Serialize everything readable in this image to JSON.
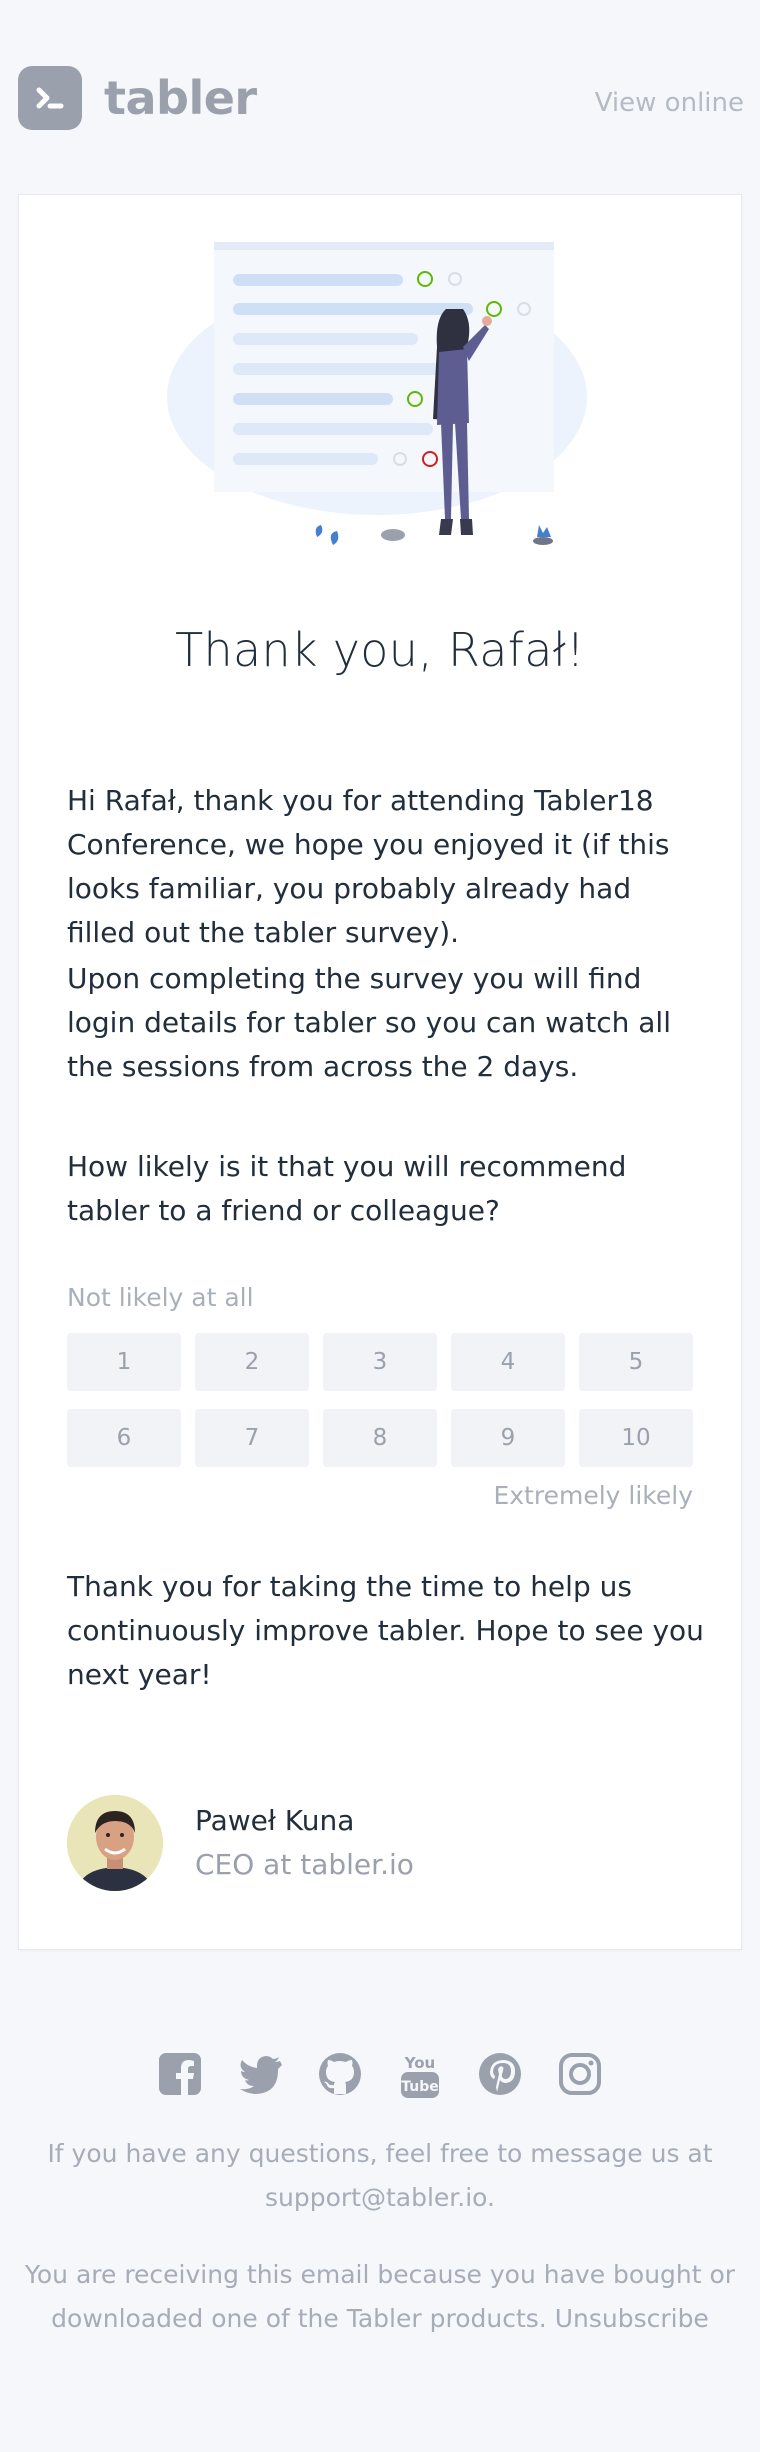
{
  "header": {
    "brand": "tabler",
    "view_online": "View online"
  },
  "card": {
    "title": "Thank you, Rafał!",
    "paragraphs": [
      "Hi Rafał, thank you for attending Tabler18 Conference, we hope you enjoyed it (if this looks familiar, you probably already had filled out the tabler survey).",
      "Upon completing the survey you will find login details for tabler so you can watch all the sessions from across the 2 days.",
      "How likely is it that you will recommend tabler to a friend or colleague?"
    ],
    "scale": {
      "low_label": "Not likely at all",
      "high_label": "Extremely likely",
      "options": [
        "1",
        "2",
        "3",
        "4",
        "5",
        "6",
        "7",
        "8",
        "9",
        "10"
      ]
    },
    "closing": "Thank you for taking the time to help us continuously improve tabler. Hope to see you next year!",
    "signature": {
      "name": "Paweł Kuna",
      "role": "CEO at tabler.io"
    }
  },
  "social": [
    "facebook-icon",
    "twitter-icon",
    "github-icon",
    "youtube-icon",
    "pinterest-icon",
    "instagram-icon"
  ],
  "footer": {
    "questions": "If you have any questions, feel free to message us at",
    "support_email": "support@tabler.io.",
    "receiving": "You are receiving this email because you have bought or downloaded one of the Tabler products.",
    "unsubscribe": "Unsubscribe"
  },
  "colors": {
    "background": "#f5f7fb",
    "muted": "#9aa0ac",
    "text": "#232e3c"
  }
}
